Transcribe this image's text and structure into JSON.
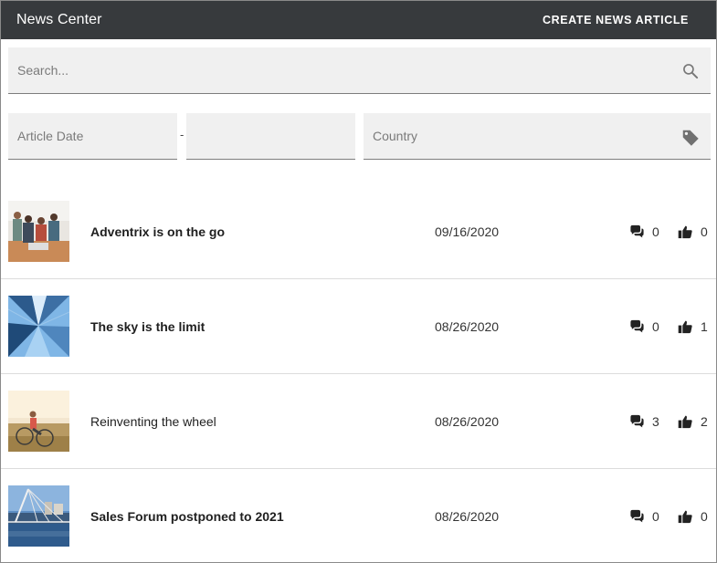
{
  "header": {
    "title": "News Center",
    "create_label": "CREATE NEWS ARTICLE",
    "background": "#373a3d"
  },
  "search": {
    "placeholder": "Search...",
    "value": "",
    "icon": "search-icon"
  },
  "filters": {
    "date_from_placeholder": "Article Date",
    "date_separator": "-",
    "date_to_placeholder": "",
    "country_placeholder": "Country",
    "country_icon": "tag-icon"
  },
  "articles": [
    {
      "title": "Adventrix is on the go",
      "bold": true,
      "date": "09/16/2020",
      "comments": "0",
      "likes": "0",
      "image": "office-team-photo"
    },
    {
      "title": "The sky is the limit",
      "bold": true,
      "date": "08/26/2020",
      "comments": "0",
      "likes": "1",
      "image": "skyscrapers-photo"
    },
    {
      "title": "Reinventing the wheel",
      "bold": false,
      "date": "08/26/2020",
      "comments": "3",
      "likes": "2",
      "image": "cyclist-photo"
    },
    {
      "title": "Sales Forum postponed to 2021",
      "bold": true,
      "date": "08/26/2020",
      "comments": "0",
      "likes": "0",
      "image": "bridge-city-photo"
    }
  ]
}
